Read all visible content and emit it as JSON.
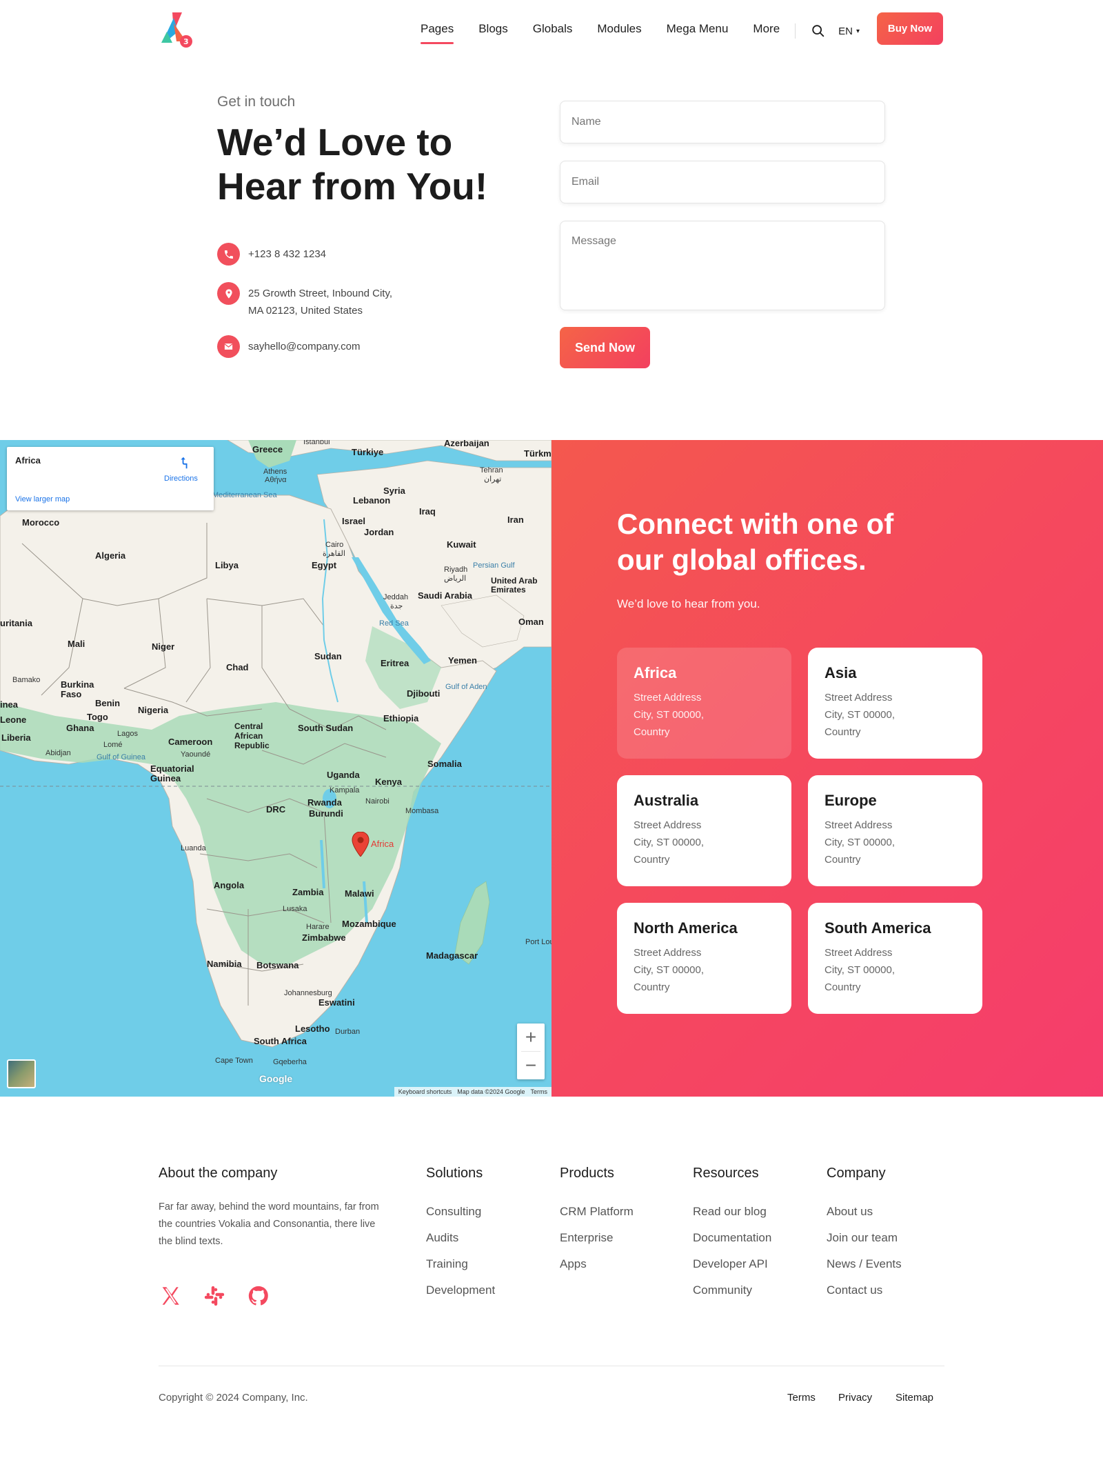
{
  "header": {
    "nav": [
      "Pages",
      "Blogs",
      "Globals",
      "Modules",
      "Mega Menu",
      "More"
    ],
    "active_nav": "Pages",
    "lang": "EN",
    "buy_label": "Buy Now"
  },
  "contact": {
    "eyebrow": "Get in touch",
    "title": "We’d Love to Hear from You!",
    "phone": "+123 8 432 1234",
    "address_line1": "25 Growth Street, Inbound City,",
    "address_line2": "MA 02123, United States",
    "email": "sayhello@company.com"
  },
  "form": {
    "name_placeholder": "Name",
    "email_placeholder": "Email",
    "message_placeholder": "Message",
    "send_label": "Send Now"
  },
  "map": {
    "card_title": "Africa",
    "directions": "Directions",
    "larger_map": "View larger map",
    "pin_label": "Africa",
    "zoom_in": "+",
    "zoom_out": "−",
    "google": "Google",
    "footer": [
      "Keyboard shortcuts",
      "Map data ©2024 Google",
      "Terms"
    ],
    "places": [
      "Greece",
      "Türkiye",
      "Athens",
      "Αθήνα",
      "Syria",
      "Lebanon",
      "Iraq",
      "Tehran",
      "تهران",
      "Iran",
      "Israel",
      "Jordan",
      "Kuwait",
      "Cairo",
      "القاهرة",
      "Egypt",
      "Riyadh",
      "الرياض",
      "Persian Gulf",
      "United Arab Emirates",
      "Jeddah",
      "جدة",
      "Saudi Arabia",
      "Oman",
      "Red Sea",
      "Morocco",
      "Algeria",
      "Libya",
      "Mali",
      "Niger",
      "Chad",
      "Sudan",
      "Eritrea",
      "Yemen",
      "Gulf of Aden",
      "Djibouti",
      "Bamako",
      "Burkina Faso",
      "Benin",
      "Togo",
      "Nigeria",
      "Ghana",
      "Lagos",
      "Lomé",
      "Abidjan",
      "Gulf of Guinea",
      "Cameroon",
      "Yaoundé",
      "Central African Republic",
      "South Sudan",
      "Ethiopia",
      "Somalia",
      "Equatorial Guinea",
      "Uganda",
      "Kampala",
      "Kenya",
      "Nairobi",
      "DRC",
      "Rwanda",
      "Burundi",
      "Mombasa",
      "Luanda",
      "Angola",
      "Zambia",
      "Malawi",
      "Lusaka",
      "Harare",
      "Zimbabwe",
      "Mozambique",
      "Madagascar",
      "Namibia",
      "Botswana",
      "Johannesburg",
      "Eswatini",
      "Lesotho",
      "Durban",
      "South Africa",
      "Cape Town",
      "Gqeberha",
      "Port Lou",
      "Liberia",
      "Leone",
      "inea",
      "uritania",
      "Mediterranean Sea",
      "Istanbul",
      "Azerbaijan",
      "Türkm"
    ]
  },
  "offices": {
    "title": "Connect with one of our global offices.",
    "subtitle": "We’d love to hear from you.",
    "active": "Africa",
    "items": [
      {
        "name": "Africa",
        "street": "Street Address",
        "city": "City, ST 00000,",
        "country": "Country"
      },
      {
        "name": "Asia",
        "street": "Street Address",
        "city": "City, ST 00000,",
        "country": "Country"
      },
      {
        "name": "Australia",
        "street": "Street Address",
        "city": "City, ST 00000,",
        "country": "Country"
      },
      {
        "name": "Europe",
        "street": "Street Address",
        "city": "City, ST 00000,",
        "country": "Country"
      },
      {
        "name": "North America",
        "street": "Street Address",
        "city": "City, ST 00000,",
        "country": "Country"
      },
      {
        "name": "South America",
        "street": "Street Address",
        "city": "City, ST 00000,",
        "country": "Country"
      }
    ]
  },
  "footer": {
    "about_heading": "About the company",
    "about_text": "Far far away, behind the word mountains, far from the countries Vokalia and Consonantia, there live the blind texts.",
    "columns": [
      {
        "heading": "Solutions",
        "links": [
          "Consulting",
          "Audits",
          "Training",
          "Development"
        ]
      },
      {
        "heading": "Products",
        "links": [
          "CRM Platform",
          "Enterprise",
          "Apps"
        ]
      },
      {
        "heading": "Resources",
        "links": [
          "Read our blog",
          "Documentation",
          "Developer API",
          "Community"
        ]
      },
      {
        "heading": "Company",
        "links": [
          "About us",
          "Join our team",
          "News / Events",
          "Contact us"
        ]
      }
    ],
    "socials": [
      "x-icon",
      "slack-icon",
      "github-icon"
    ],
    "copyright": "Copyright © 2024 Company, Inc.",
    "legal": [
      "Terms",
      "Privacy",
      "Sitemap"
    ]
  },
  "colors": {
    "accent": "#f4495f",
    "accent_orange": "#f56447",
    "map_water": "#6fcde8",
    "map_land": "#f4f1ea",
    "map_green": "#a9dbb9"
  }
}
